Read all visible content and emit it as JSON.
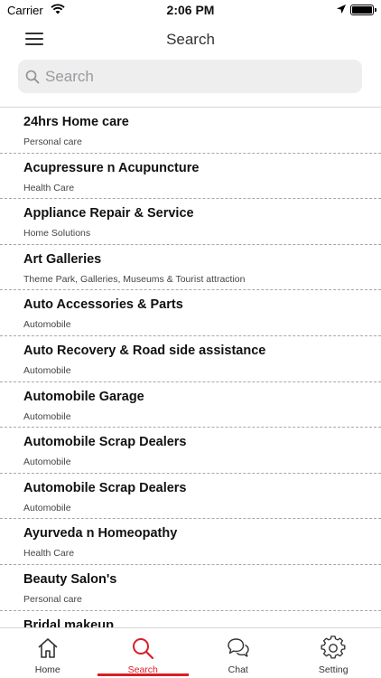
{
  "status_bar": {
    "carrier": "Carrier",
    "time": "2:06 PM"
  },
  "nav": {
    "title": "Search"
  },
  "search": {
    "placeholder": "Search",
    "value": ""
  },
  "list": [
    {
      "name": "24hrs Home care",
      "category": "Personal care"
    },
    {
      "name": "Acupressure n Acupuncture",
      "category": "Health Care"
    },
    {
      "name": "Appliance Repair & Service",
      "category": "Home Solutions"
    },
    {
      "name": "Art Galleries",
      "category": "Theme Park, Galleries, Museums  & Tourist attraction"
    },
    {
      "name": "Auto Accessories & Parts",
      "category": "Automobile"
    },
    {
      "name": "Auto Recovery & Road side assistance",
      "category": "Automobile"
    },
    {
      "name": "Automobile Garage",
      "category": "Automobile"
    },
    {
      "name": "Automobile Scrap Dealers",
      "category": "Automobile"
    },
    {
      "name": "Automobile Scrap Dealers",
      "category": "Automobile"
    },
    {
      "name": "Ayurveda n Homeopathy",
      "category": "Health Care"
    },
    {
      "name": "Beauty Salon's",
      "category": "Personal care"
    },
    {
      "name": "Bridal makeup",
      "category": ""
    }
  ],
  "tabs": [
    {
      "label": "Home",
      "icon": "home-icon"
    },
    {
      "label": "Search",
      "icon": "search-icon",
      "active": true
    },
    {
      "label": "Chat",
      "icon": "chat-icon"
    },
    {
      "label": "Setting",
      "icon": "gear-icon"
    }
  ],
  "colors": {
    "accent": "#d81f26",
    "search_bg": "#eeeeef"
  }
}
